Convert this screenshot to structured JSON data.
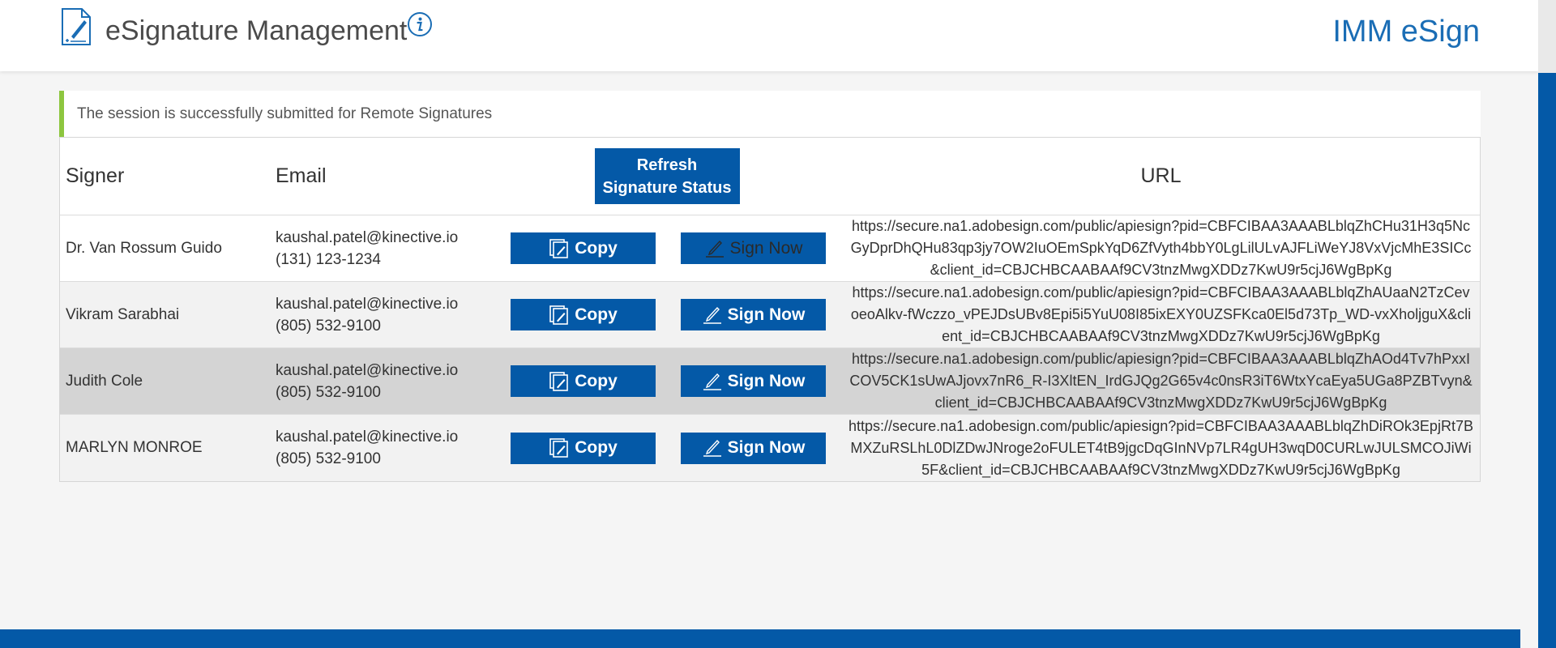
{
  "header": {
    "title": "eSignature Management",
    "brand": "IMM eSign"
  },
  "notice": {
    "message": "The session is successfully submitted for Remote Signatures"
  },
  "table": {
    "headers": {
      "signer": "Signer",
      "email": "Email",
      "refresh_line1": "Refresh",
      "refresh_line2": "Signature Status",
      "url": "URL"
    },
    "copy_label": "Copy",
    "sign_label": "Sign Now",
    "rows": [
      {
        "signer": "Dr. Van Rossum Guido",
        "email": "kaushal.patel@kinective.io",
        "phone": "(131) 123-1234",
        "url": "https://secure.na1.adobesign.com/public/apiesign?pid=CBFCIBAA3AAABLblqZhCHu31H3q5NcGyDprDhQHu83qp3jy7OW2IuOEmSpkYqD6ZfVyth4bbY0LgLilULvAJFLiWeYJ8VxVjcMhE3SICc&client_id=CBJCHBCAABAAf9CV3tnzMwgXDDz7KwU9r5cjJ6WgBpKg"
      },
      {
        "signer": "Vikram Sarabhai",
        "email": "kaushal.patel@kinective.io",
        "phone": "(805) 532-9100",
        "url": "https://secure.na1.adobesign.com/public/apiesign?pid=CBFCIBAA3AAABLblqZhAUaaN2TzCevoeoAlkv-fWczzo_vPEJDsUBv8Epi5i5YuU08I85ixEXY0UZSFKca0El5d73Tp_WD-vxXholjguX&client_id=CBJCHBCAABAAf9CV3tnzMwgXDDz7KwU9r5cjJ6WgBpKg"
      },
      {
        "signer": "Judith Cole",
        "email": "kaushal.patel@kinective.io",
        "phone": "(805) 532-9100",
        "url": "https://secure.na1.adobesign.com/public/apiesign?pid=CBFCIBAA3AAABLblqZhAOd4Tv7hPxxICOV5CK1sUwAJjovx7nR6_R-I3XltEN_IrdGJQg2G65v4c0nsR3iT6WtxYcaEya5UGa8PZBTvyn&client_id=CBJCHBCAABAAf9CV3tnzMwgXDDz7KwU9r5cjJ6WgBpKg"
      },
      {
        "signer": "MARLYN MONROE",
        "email": "kaushal.patel@kinective.io",
        "phone": "(805) 532-9100",
        "url": "https://secure.na1.adobesign.com/public/apiesign?pid=CBFCIBAA3AAABLblqZhDiROk3EpjRt7BMXZuRSLhL0DlZDwJNroge2oFULET4tB9jgcDqGInNVp7LR4gUH3wqD0CURLwJULSMCOJiWi5F&client_id=CBJCHBCAABAAf9CV3tnzMwgXDDz7KwU9r5cjJ6WgBpKg"
      }
    ]
  },
  "icons": {
    "header_doc": "signed-document-icon",
    "info": "info-icon",
    "copy": "copy-icon",
    "sign": "pen-icon"
  },
  "colors": {
    "primary": "#0459a7",
    "brand_text": "#1a6db5",
    "notice_accent": "#8dc63f",
    "highlight_row": "#d4d4d4"
  }
}
